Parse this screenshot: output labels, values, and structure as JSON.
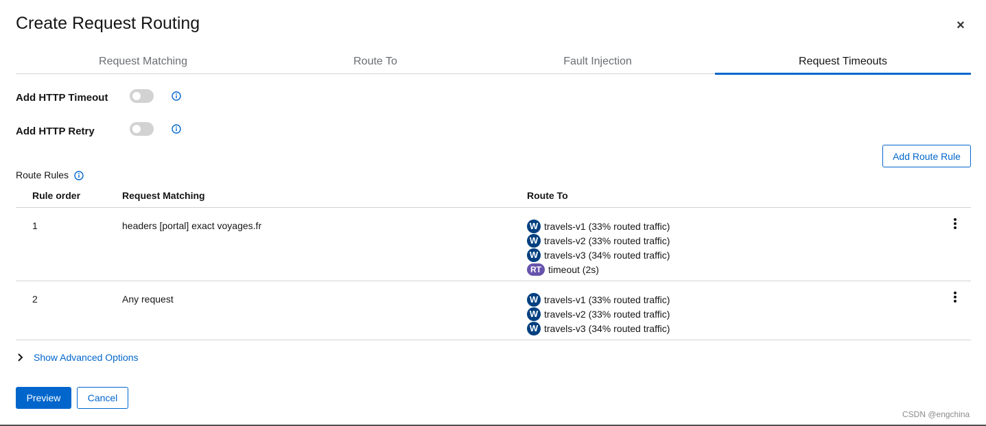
{
  "dialog": {
    "title": "Create Request Routing",
    "close_label": "×"
  },
  "tabs": [
    {
      "label": "Request Matching",
      "active": false
    },
    {
      "label": "Route To",
      "active": false
    },
    {
      "label": "Fault Injection",
      "active": false
    },
    {
      "label": "Request Timeouts",
      "active": true
    }
  ],
  "form": {
    "http_timeout_label": "Add HTTP Timeout",
    "http_timeout_enabled": false,
    "http_retry_label": "Add HTTP Retry",
    "http_retry_enabled": false
  },
  "add_route_rule_label": "Add Route Rule",
  "route_rules": {
    "section_label": "Route Rules",
    "columns": [
      "Rule order",
      "Request Matching",
      "Route To"
    ],
    "rows": [
      {
        "order": "1",
        "matching": "headers [portal] exact voyages.fr",
        "routes": [
          {
            "badge": "W",
            "text": "travels-v1 (33% routed traffic)"
          },
          {
            "badge": "W",
            "text": "travels-v2 (33% routed traffic)"
          },
          {
            "badge": "W",
            "text": "travels-v3 (34% routed traffic)"
          },
          {
            "badge": "RT",
            "text": "timeout (2s)"
          }
        ]
      },
      {
        "order": "2",
        "matching": "Any request",
        "routes": [
          {
            "badge": "W",
            "text": "travels-v1 (33% routed traffic)"
          },
          {
            "badge": "W",
            "text": "travels-v2 (33% routed traffic)"
          },
          {
            "badge": "W",
            "text": "travels-v3 (34% routed traffic)"
          }
        ]
      }
    ]
  },
  "advanced_options_label": "Show Advanced Options",
  "footer": {
    "preview_label": "Preview",
    "cancel_label": "Cancel"
  },
  "watermark": "CSDN @engchina",
  "colors": {
    "primary": "#0066cc",
    "workload_badge": "#004080",
    "timeout_badge": "#6753ac",
    "switch_off": "#d2d2d2"
  },
  "icons": {
    "close": "close-icon",
    "info": "info-icon",
    "kebab": "kebab-icon",
    "chevron": "chevron-right-icon"
  }
}
